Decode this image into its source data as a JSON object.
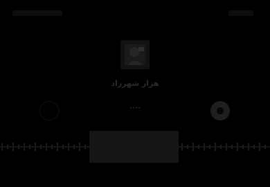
{
  "call": {
    "contact_name": "هزار شهرزاد",
    "duration": "••••",
    "subtitle": ""
  },
  "icons": {
    "left_button": "mute-icon",
    "right_button": "record-icon",
    "avatar": "contact-avatar-icon"
  },
  "colors": {
    "background": "#000000",
    "text": "#2a2a2a",
    "panel": "#161616"
  }
}
